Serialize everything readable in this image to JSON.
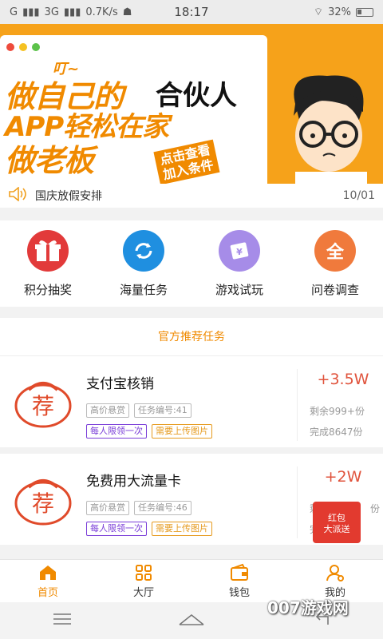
{
  "statusbar": {
    "carrier": "G",
    "network": "3G",
    "speed": "0.7K/s",
    "time": "18:17",
    "battery": "32%"
  },
  "banner": {
    "ding": "叮~",
    "line1": "做自己的",
    "line2": "APP轻松在家",
    "line3": "做老板",
    "partner": "合伙人",
    "click": "点击查看\n加入条件"
  },
  "notice": {
    "text": "国庆放假安排",
    "date": "10/01"
  },
  "categories": [
    {
      "label": "积分抽奖",
      "icon": "gift-icon",
      "color": "#e23a3a"
    },
    {
      "label": "海量任务",
      "icon": "refresh-icon",
      "color": "#1f8fe0"
    },
    {
      "label": "游戏试玩",
      "icon": "card-icon",
      "color": "#a68ce8"
    },
    {
      "label": "问卷调查",
      "icon": "quan-icon",
      "color": "#f07a3c",
      "glyph": "全"
    }
  ],
  "recommend": {
    "title": "官方推荐任务",
    "tasks": [
      {
        "name": "支付宝核销",
        "tag_price": "高价悬赏",
        "tag_id": "任务编号:41",
        "tag_limit": "每人限领一次",
        "tag_upload": "需要上传图片",
        "reward": "+3.5W",
        "remaining": "剩余999+份",
        "done": "完成8647份",
        "logo": "荐"
      },
      {
        "name": "免费用大流量卡",
        "tag_price": "高价悬赏",
        "tag_id": "任务编号:46",
        "tag_limit": "每人限领一次",
        "tag_upload": "需要上传图片",
        "reward": "+2W",
        "remaining": "剩余",
        "remaining_tail": "份",
        "done": "完",
        "logo": "荐"
      }
    ]
  },
  "redpack": {
    "line1": "红包",
    "line2": "大派送"
  },
  "tabs": [
    {
      "label": "首页",
      "icon": "home-icon"
    },
    {
      "label": "大厅",
      "icon": "grid-icon"
    },
    {
      "label": "钱包",
      "icon": "wallet-icon"
    },
    {
      "label": "我的",
      "icon": "user-icon"
    }
  ],
  "watermark": "007游戏网",
  "colors": {
    "accent": "#f08a00",
    "reward": "#e0533c",
    "banner": "#f6a21a"
  }
}
